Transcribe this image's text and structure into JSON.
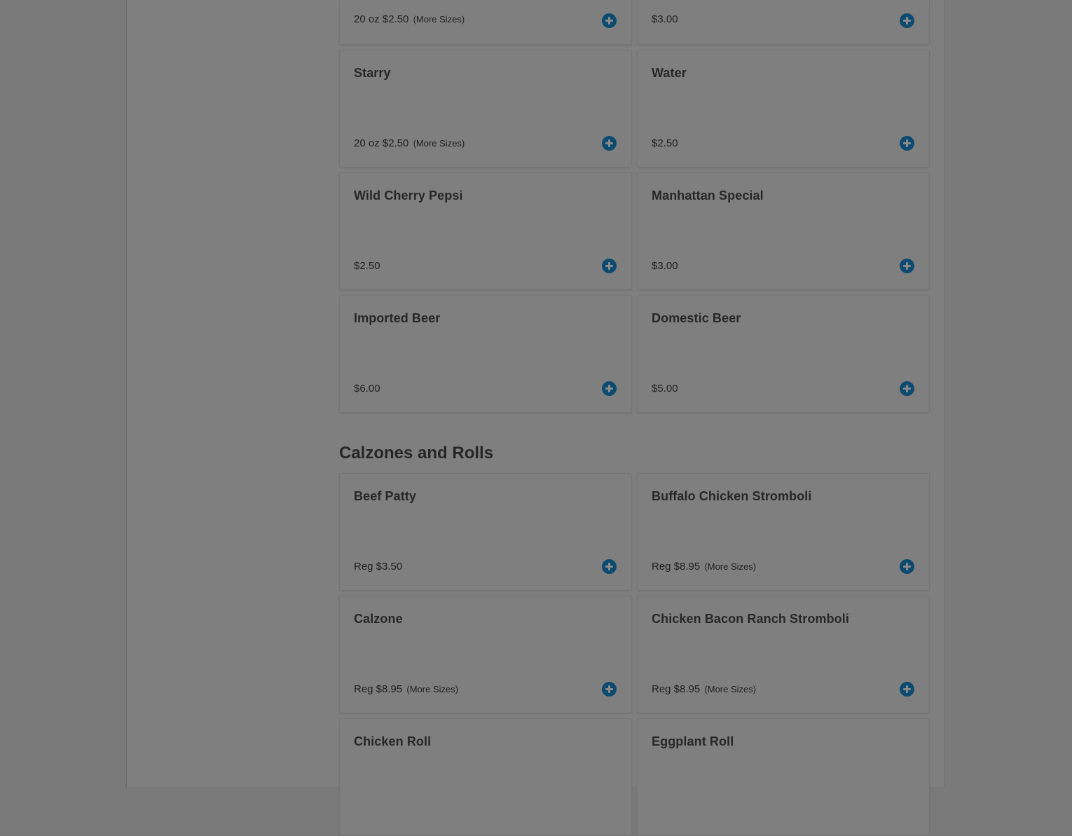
{
  "colors": {
    "overlay_background": "#7f7f7f",
    "add_button": "#0d4a70",
    "text": "#272727"
  },
  "drinks_section": {
    "items": [
      {
        "name": "",
        "price": "20 oz $2.50",
        "more_sizes": "(More Sizes)",
        "icon": "plus-circle-icon"
      },
      {
        "name": "",
        "price": "$3.00",
        "more_sizes": "",
        "icon": "plus-circle-icon"
      },
      {
        "name": "Starry",
        "price": "20 oz $2.50",
        "more_sizes": "(More Sizes)",
        "icon": "plus-circle-icon"
      },
      {
        "name": "Water",
        "price": "$2.50",
        "more_sizes": "",
        "icon": "plus-circle-icon"
      },
      {
        "name": "Wild Cherry Pepsi",
        "price": "$2.50",
        "more_sizes": "",
        "icon": "plus-circle-icon"
      },
      {
        "name": "Manhattan Special",
        "price": "$3.00",
        "more_sizes": "",
        "icon": "plus-circle-icon"
      },
      {
        "name": "Imported Beer",
        "price": "$6.00",
        "more_sizes": "",
        "icon": "plus-circle-icon"
      },
      {
        "name": "Domestic Beer",
        "price": "$5.00",
        "more_sizes": "",
        "icon": "plus-circle-icon"
      }
    ]
  },
  "calzones_section": {
    "title": "Calzones and Rolls",
    "items": [
      {
        "name": "Beef Patty",
        "price": "Reg $3.50",
        "more_sizes": "",
        "icon": "plus-circle-icon"
      },
      {
        "name": "Buffalo Chicken Stromboli",
        "price": "Reg $8.95",
        "more_sizes": "(More Sizes)",
        "icon": "plus-circle-icon"
      },
      {
        "name": "Calzone",
        "price": "Reg $8.95",
        "more_sizes": "(More Sizes)",
        "icon": "plus-circle-icon"
      },
      {
        "name": "Chicken Bacon Ranch Stromboli",
        "price": "Reg $8.95",
        "more_sizes": "(More Sizes)",
        "icon": "plus-circle-icon"
      },
      {
        "name": "Chicken Roll",
        "price": "",
        "more_sizes": "",
        "icon": "plus-circle-icon"
      },
      {
        "name": "Eggplant Roll",
        "price": "",
        "more_sizes": "",
        "icon": "plus-circle-icon"
      }
    ]
  }
}
